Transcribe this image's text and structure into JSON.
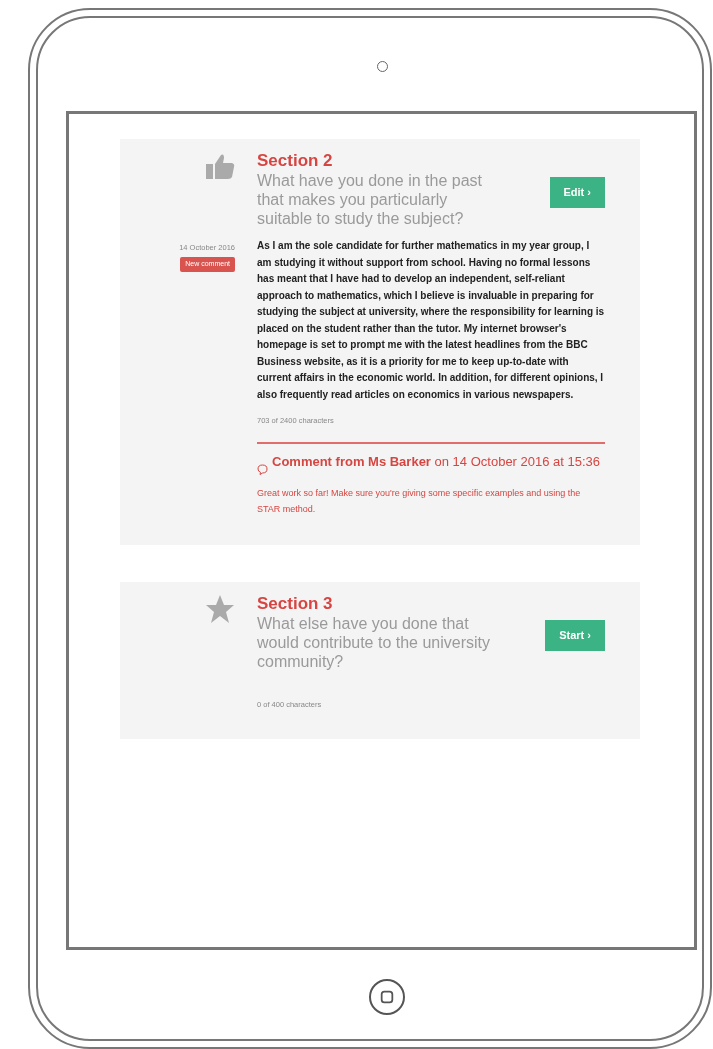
{
  "sections": [
    {
      "kind": "answered",
      "title": "Section 2",
      "question": "What have you done in the past that makes you particularly suitable to study the subject?",
      "button": "Edit ›",
      "date": "14 October 2016",
      "badge": "New comment",
      "answer": "As I am the sole candidate for further mathematics in my year group, I am studying it without support from school. Having no formal lessons has meant that I have had to develop an independent, self-reliant approach to mathematics, which I believe is invaluable in preparing for studying the subject at university, where the responsibility for learning is placed on the student rather than the tutor. My internet browser's homepage is set to prompt me with the latest headlines from the BBC Business website, as it is a priority for me to keep up-to-date with current affairs in the economic world. In addition, for different opinions, I also frequently read articles on economics in various newspapers.",
      "char_count": "703 of 2400 characters",
      "comment": {
        "heading": "**Comment from Ms Barker** on 14 October 2016 at 15:36",
        "text": "Great work so far! Make sure you're giving some specific examples and using the STAR method."
      }
    },
    {
      "kind": "unstarted",
      "title": "Section 3",
      "question": "What else have you done that would contribute to the university community?",
      "button": "Start ›",
      "char_count": "0 of 400 characters"
    }
  ]
}
